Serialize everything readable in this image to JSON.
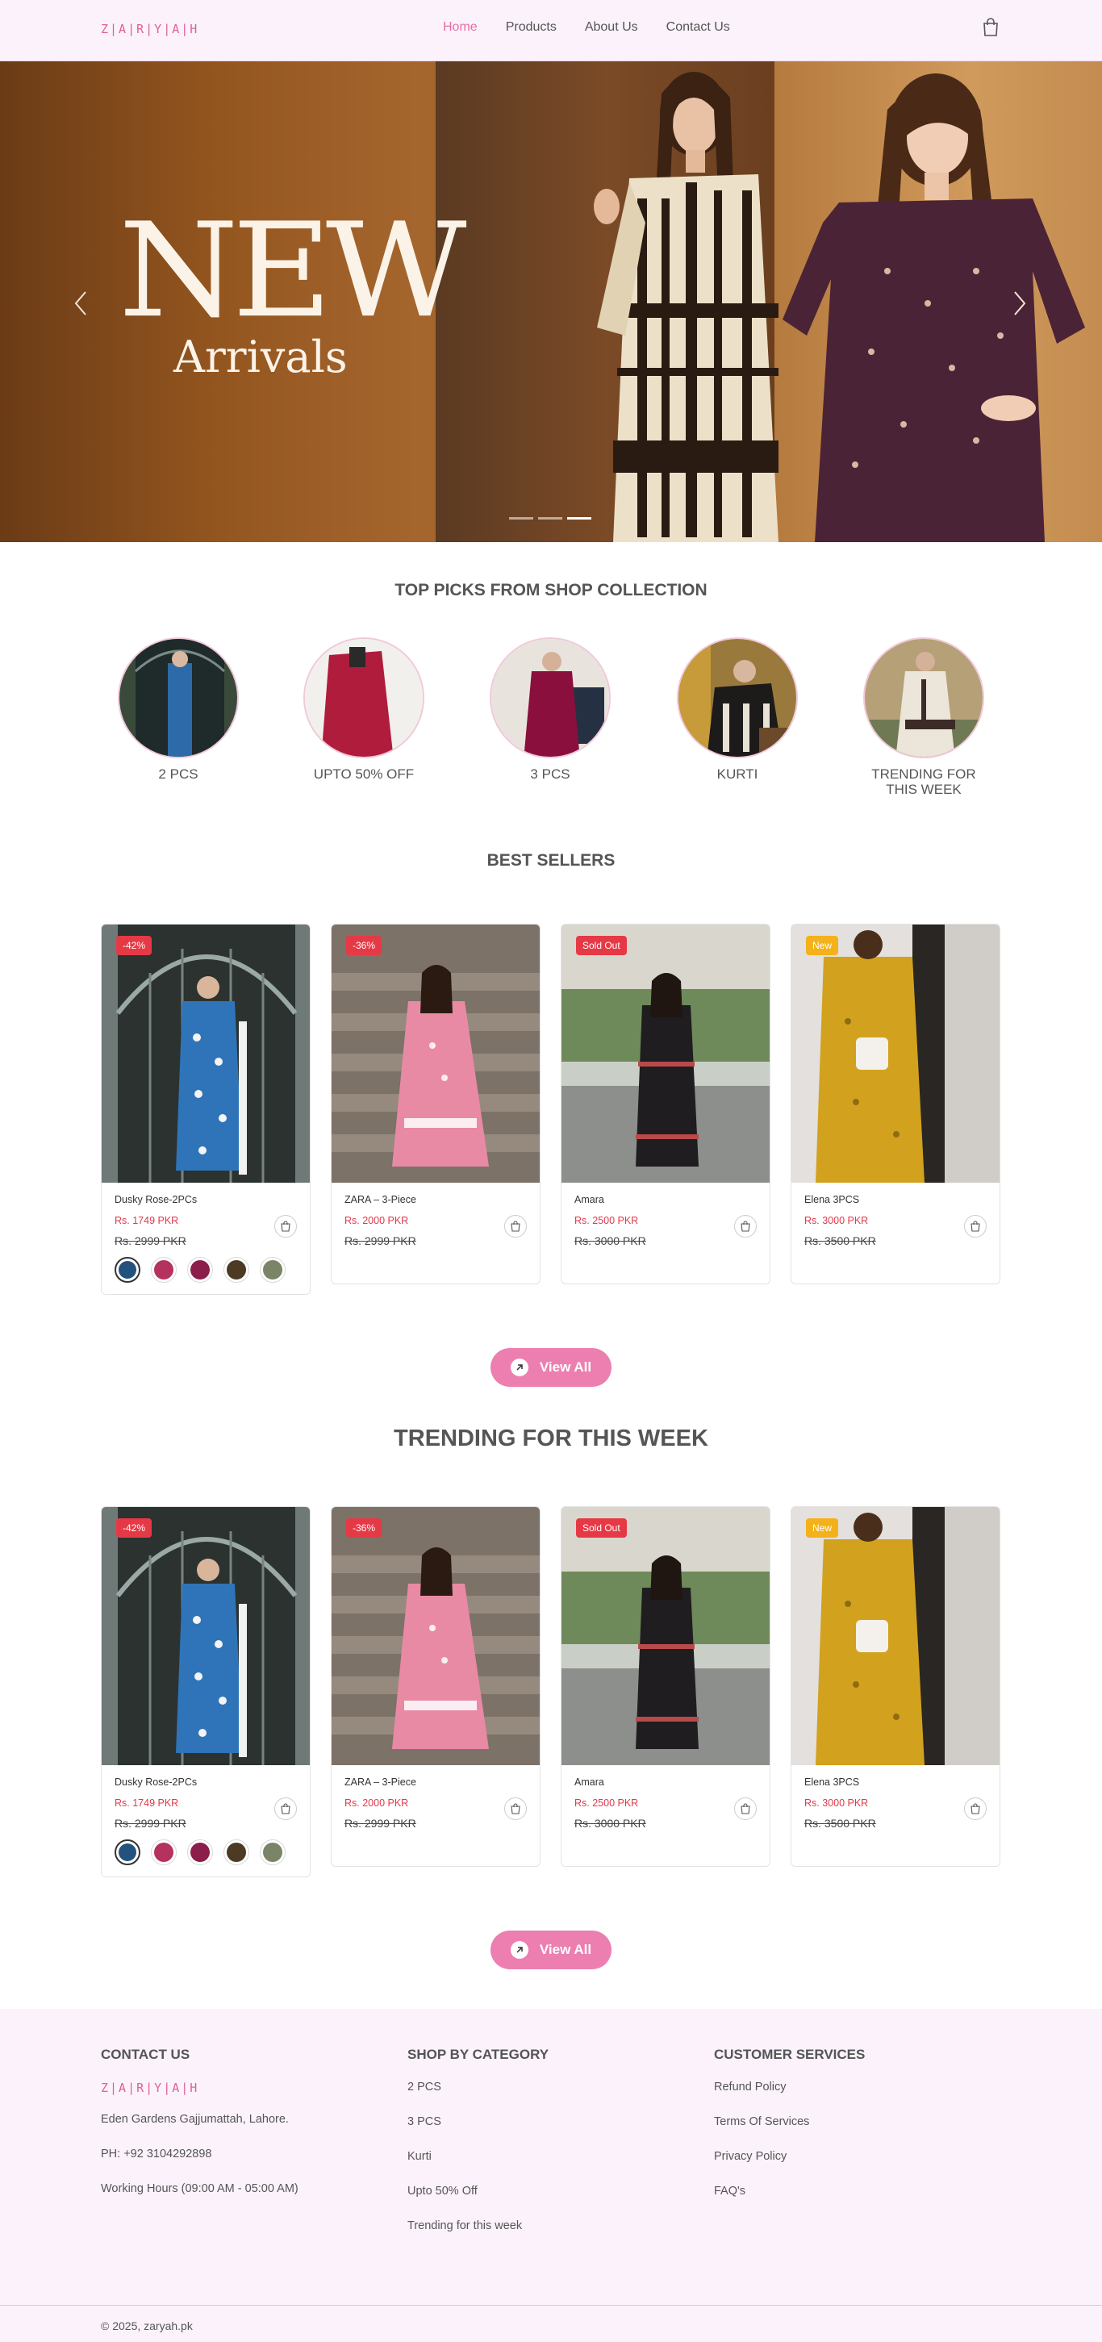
{
  "header": {
    "logo": "Z|A|R|Y|A|H",
    "nav": [
      "Home",
      "Products",
      "About Us",
      "Contact Us"
    ],
    "active": "Home"
  },
  "hero": {
    "title": "NEW",
    "subtitle": "Arrivals",
    "slides": 3,
    "active_slide": 3
  },
  "top_picks": {
    "title": "TOP PICKS FROM SHOP COLLECTION",
    "items": [
      {
        "label": "2 PCS"
      },
      {
        "label": "UPTO 50% OFF"
      },
      {
        "label": "3 PCS"
      },
      {
        "label": "KURTI"
      },
      {
        "label": "TRENDING FOR THIS WEEK"
      }
    ]
  },
  "best_sellers": {
    "title": "BEST SELLERS",
    "products": [
      {
        "badge": "-42%",
        "name": "Dusky Rose-2PCs",
        "price": "Rs. 1749 PKR",
        "old_price": "Rs. 2999 PKR"
      },
      {
        "badge": "-36%",
        "name": "ZARA – 3-Piece",
        "price": "Rs. 2000 PKR",
        "old_price": "Rs. 2999 PKR"
      },
      {
        "badge": "Sold Out",
        "name": "Amara",
        "price": "Rs. 2500 PKR",
        "old_price": "Rs. 3000 PKR"
      },
      {
        "badge": "New",
        "name": "Elena 3PCS",
        "price": "Rs. 3000 PKR",
        "old_price": "Rs. 3500 PKR"
      }
    ],
    "view_all": "View All"
  },
  "trending": {
    "title": "TRENDING FOR THIS WEEK",
    "products": [
      {
        "badge": "-42%",
        "name": "Dusky Rose-2PCs",
        "price": "Rs. 1749 PKR",
        "old_price": "Rs. 2999 PKR"
      },
      {
        "badge": "-36%",
        "name": "ZARA – 3-Piece",
        "price": "Rs. 2000 PKR",
        "old_price": "Rs. 2999 PKR"
      },
      {
        "badge": "Sold Out",
        "name": "Amara",
        "price": "Rs. 2500 PKR",
        "old_price": "Rs. 3000 PKR"
      },
      {
        "badge": "New",
        "name": "Elena 3PCS",
        "price": "Rs. 3000 PKR",
        "old_price": "Rs. 3500 PKR"
      }
    ],
    "view_all": "View All"
  },
  "footer": {
    "contact": {
      "title": "CONTACT US",
      "logo": "Z|A|R|Y|A|H",
      "address": "Eden Gardens Gajjumattah, Lahore.",
      "phone": "PH: +92 3104292898",
      "hours": "Working Hours (09:00 AM - 05:00 AM)"
    },
    "categories": {
      "title": "SHOP BY CATEGORY",
      "items": [
        "2 PCS",
        "3 PCS",
        "Kurti",
        "Upto 50% Off",
        "Trending for this week"
      ]
    },
    "services": {
      "title": "CUSTOMER SERVICES",
      "items": [
        "Refund Policy",
        "Terms Of Services",
        "Privacy Policy",
        "FAQ's"
      ]
    },
    "copyright": "© 2025, zaryah.pk"
  },
  "colors": {
    "brand_pink": "#e56fa4",
    "button_pink": "#ec7fb0",
    "sale_red": "#e63946",
    "new_yellow": "#f3b21b",
    "header_bg": "#fbf2fb"
  },
  "icons": [
    "shopping-bag-icon",
    "chevron-left-icon",
    "chevron-right-icon",
    "arrow-up-right-icon"
  ]
}
